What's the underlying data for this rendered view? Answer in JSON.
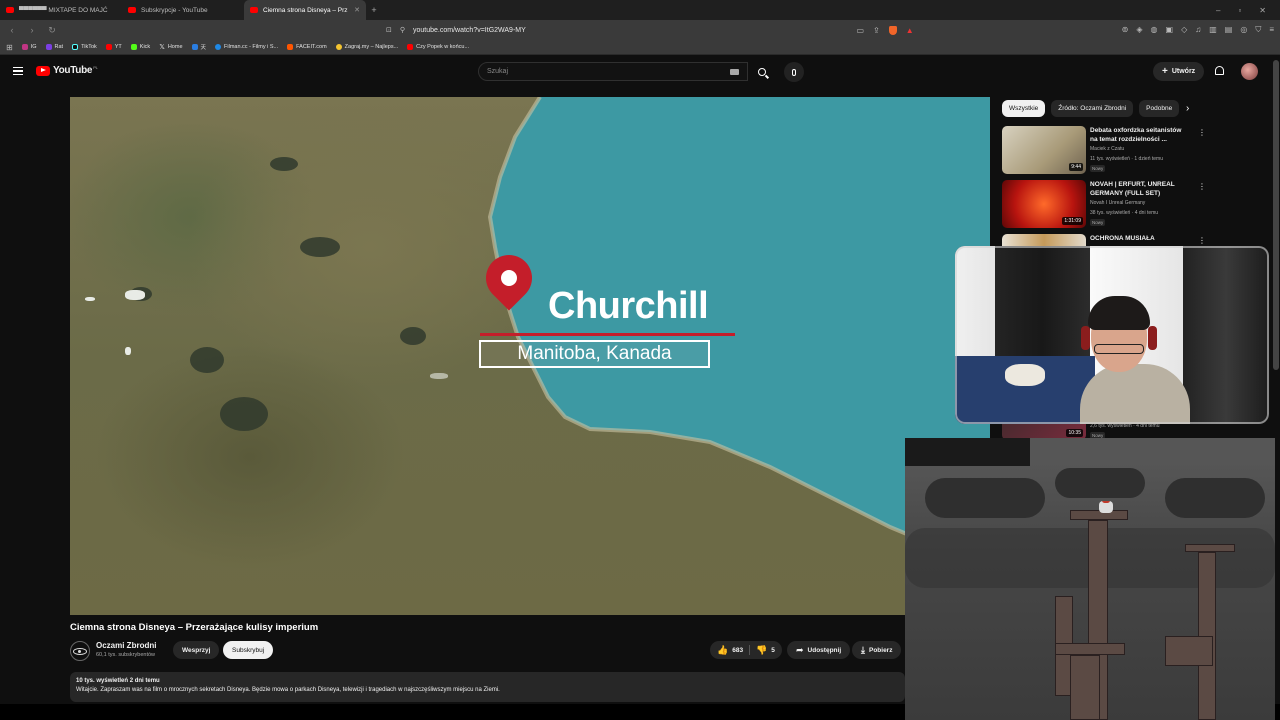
{
  "browser": {
    "tabs": [
      {
        "label": "▀▀▀▀▀▀ MIXTAPE DO MAJĆ",
        "active": false
      },
      {
        "label": "Subskrypcje - YouTube",
        "active": false
      },
      {
        "label": "Ciemna strona Disneya – Prz",
        "active": true
      }
    ],
    "url": "youtube.com/watch?v=ItG2WA9-MY",
    "bookmarks": [
      "IG",
      "Rat",
      "TikTok",
      "YT",
      "Kick",
      "Home",
      "天",
      "Filman.cc - Filmy i S...",
      "FACEIT.com",
      "Zagraj.my – Najleps...",
      "Czy Popek w końcu..."
    ]
  },
  "youtube": {
    "logo_text": "YouTube",
    "logo_region": "PL",
    "search_placeholder": "Szukaj",
    "create_label": "Utwórz"
  },
  "video": {
    "overlay_place": "Churchill",
    "overlay_region": "Manitoba, Kanada",
    "title": "Ciemna strona Disneya – Przerażające kulisy imperium",
    "channel": "Oczami Zbrodni",
    "subscribers": "60,1 tys. subskrybentów",
    "support_label": "Wesprzyj",
    "subscribe_label": "Subskrybuj",
    "likes": "683",
    "dislikes": "5",
    "share_label": "Udostępnij",
    "download_label": "Pobierz",
    "views_meta": "10 tys. wyświetleń  2 dni temu",
    "description": "Witajcie. Zapraszam was na film o mrocznych sekretach Disneya. Będzie mowa o parkach Disneya, telewizji i tragediach w najszczęśliwszym miejscu na Ziemi."
  },
  "sidebar": {
    "chips": [
      "Wszystkie",
      "Źródło: Oczami Zbrodni",
      "Podobne"
    ],
    "recommendations": [
      {
        "title": "Debata oxfordzka seitanistów na temat rozdzielności ...",
        "channel": "Maciek z Czatu",
        "meta": "11 tys. wyświetleń · 1 dzień temu",
        "badge": "Nowy",
        "duration": "9:44"
      },
      {
        "title": "NOVAH | ERFURT, UNREAL GERMANY (FULL SET)",
        "channel": "Novah I Unreal Germany",
        "meta": "38 tys. wyświetleń · 4 dni temu",
        "badge": "Nowy",
        "duration": "1:31:09"
      },
      {
        "title": "OCHRONA MUSIAŁA",
        "channel": "",
        "meta": "",
        "badge": "",
        "duration": ""
      },
      {
        "title": "",
        "channel": "",
        "meta": "2,6 tys. wyświetleń · 4 dni temu",
        "badge": "Nowy",
        "duration": "10:35"
      }
    ]
  },
  "colors": {
    "accent_red": "#ff0000",
    "pin_red": "#c41e2a",
    "sea": "#3d99a3"
  }
}
